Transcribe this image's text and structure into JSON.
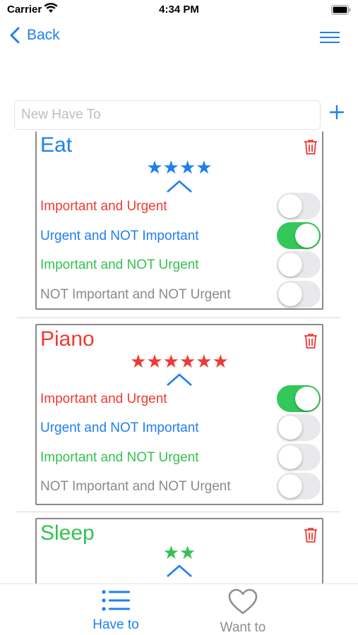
{
  "status": {
    "carrier": "Carrier",
    "time": "4:34 PM"
  },
  "nav": {
    "back_label": "Back"
  },
  "new_item": {
    "placeholder": "New Have To"
  },
  "colors": {
    "accent": "#1f7ff0",
    "red": "#ee3a32",
    "green": "#35c152",
    "gray": "#8a8a8e",
    "toggle_on": "#34c759"
  },
  "items": [
    {
      "title": "Eat",
      "title_color": "red_blue",
      "stars": "★★★★",
      "options": [
        {
          "label": "Important and Urgent",
          "on": false
        },
        {
          "label": "Urgent and NOT Important",
          "on": true
        },
        {
          "label": "Important and NOT Urgent",
          "on": false
        },
        {
          "label": "NOT Important and NOT Urgent",
          "on": false
        }
      ]
    },
    {
      "title": "Piano",
      "stars": "★★★★★★",
      "options": [
        {
          "label": "Important and Urgent",
          "on": true
        },
        {
          "label": "Urgent and NOT Important",
          "on": false
        },
        {
          "label": "Important and NOT Urgent",
          "on": false
        },
        {
          "label": "NOT Important and NOT Urgent",
          "on": false
        }
      ]
    },
    {
      "title": "Sleep",
      "stars": "★★"
    }
  ],
  "tabs": [
    {
      "label": "Have to",
      "icon": "list-icon",
      "selected": true
    },
    {
      "label": "Want to",
      "icon": "heart-icon",
      "selected": false
    }
  ]
}
